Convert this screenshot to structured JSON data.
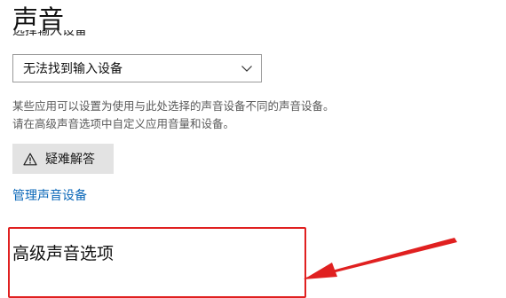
{
  "page": {
    "title": "声音"
  },
  "input": {
    "section_label": "选择输入设备",
    "selected_device": "无法找到输入设备"
  },
  "description": {
    "line1": "某些应用可以设置为使用与此处选择的声音设备不同的声音设备。",
    "line2": "请在高级声音选项中自定义应用音量和设备。"
  },
  "buttons": {
    "troubleshoot": "疑难解答"
  },
  "links": {
    "manage_devices": "管理声音设备"
  },
  "advanced": {
    "heading": "高级声音选项"
  },
  "icons": {
    "select_chevron": "chevron-down-icon",
    "troubleshoot": "warning-triangle-icon",
    "annotation": "arrow-icon"
  },
  "colors": {
    "link": "#0a67b8",
    "button_bg": "#e3e3e3",
    "highlight": "#e02020",
    "description_text": "#5a5a5a"
  }
}
